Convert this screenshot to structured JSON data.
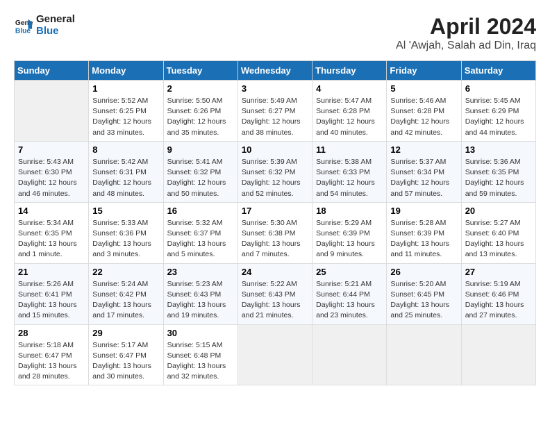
{
  "logo": {
    "line1": "General",
    "line2": "Blue"
  },
  "title": "April 2024",
  "location": "Al 'Awjah, Salah ad Din, Iraq",
  "weekdays": [
    "Sunday",
    "Monday",
    "Tuesday",
    "Wednesday",
    "Thursday",
    "Friday",
    "Saturday"
  ],
  "weeks": [
    [
      null,
      {
        "day": 1,
        "sunrise": "Sunrise: 5:52 AM",
        "sunset": "Sunset: 6:25 PM",
        "daylight": "Daylight: 12 hours and 33 minutes."
      },
      {
        "day": 2,
        "sunrise": "Sunrise: 5:50 AM",
        "sunset": "Sunset: 6:26 PM",
        "daylight": "Daylight: 12 hours and 35 minutes."
      },
      {
        "day": 3,
        "sunrise": "Sunrise: 5:49 AM",
        "sunset": "Sunset: 6:27 PM",
        "daylight": "Daylight: 12 hours and 38 minutes."
      },
      {
        "day": 4,
        "sunrise": "Sunrise: 5:47 AM",
        "sunset": "Sunset: 6:28 PM",
        "daylight": "Daylight: 12 hours and 40 minutes."
      },
      {
        "day": 5,
        "sunrise": "Sunrise: 5:46 AM",
        "sunset": "Sunset: 6:28 PM",
        "daylight": "Daylight: 12 hours and 42 minutes."
      },
      {
        "day": 6,
        "sunrise": "Sunrise: 5:45 AM",
        "sunset": "Sunset: 6:29 PM",
        "daylight": "Daylight: 12 hours and 44 minutes."
      }
    ],
    [
      {
        "day": 7,
        "sunrise": "Sunrise: 5:43 AM",
        "sunset": "Sunset: 6:30 PM",
        "daylight": "Daylight: 12 hours and 46 minutes."
      },
      {
        "day": 8,
        "sunrise": "Sunrise: 5:42 AM",
        "sunset": "Sunset: 6:31 PM",
        "daylight": "Daylight: 12 hours and 48 minutes."
      },
      {
        "day": 9,
        "sunrise": "Sunrise: 5:41 AM",
        "sunset": "Sunset: 6:32 PM",
        "daylight": "Daylight: 12 hours and 50 minutes."
      },
      {
        "day": 10,
        "sunrise": "Sunrise: 5:39 AM",
        "sunset": "Sunset: 6:32 PM",
        "daylight": "Daylight: 12 hours and 52 minutes."
      },
      {
        "day": 11,
        "sunrise": "Sunrise: 5:38 AM",
        "sunset": "Sunset: 6:33 PM",
        "daylight": "Daylight: 12 hours and 54 minutes."
      },
      {
        "day": 12,
        "sunrise": "Sunrise: 5:37 AM",
        "sunset": "Sunset: 6:34 PM",
        "daylight": "Daylight: 12 hours and 57 minutes."
      },
      {
        "day": 13,
        "sunrise": "Sunrise: 5:36 AM",
        "sunset": "Sunset: 6:35 PM",
        "daylight": "Daylight: 12 hours and 59 minutes."
      }
    ],
    [
      {
        "day": 14,
        "sunrise": "Sunrise: 5:34 AM",
        "sunset": "Sunset: 6:35 PM",
        "daylight": "Daylight: 13 hours and 1 minute."
      },
      {
        "day": 15,
        "sunrise": "Sunrise: 5:33 AM",
        "sunset": "Sunset: 6:36 PM",
        "daylight": "Daylight: 13 hours and 3 minutes."
      },
      {
        "day": 16,
        "sunrise": "Sunrise: 5:32 AM",
        "sunset": "Sunset: 6:37 PM",
        "daylight": "Daylight: 13 hours and 5 minutes."
      },
      {
        "day": 17,
        "sunrise": "Sunrise: 5:30 AM",
        "sunset": "Sunset: 6:38 PM",
        "daylight": "Daylight: 13 hours and 7 minutes."
      },
      {
        "day": 18,
        "sunrise": "Sunrise: 5:29 AM",
        "sunset": "Sunset: 6:39 PM",
        "daylight": "Daylight: 13 hours and 9 minutes."
      },
      {
        "day": 19,
        "sunrise": "Sunrise: 5:28 AM",
        "sunset": "Sunset: 6:39 PM",
        "daylight": "Daylight: 13 hours and 11 minutes."
      },
      {
        "day": 20,
        "sunrise": "Sunrise: 5:27 AM",
        "sunset": "Sunset: 6:40 PM",
        "daylight": "Daylight: 13 hours and 13 minutes."
      }
    ],
    [
      {
        "day": 21,
        "sunrise": "Sunrise: 5:26 AM",
        "sunset": "Sunset: 6:41 PM",
        "daylight": "Daylight: 13 hours and 15 minutes."
      },
      {
        "day": 22,
        "sunrise": "Sunrise: 5:24 AM",
        "sunset": "Sunset: 6:42 PM",
        "daylight": "Daylight: 13 hours and 17 minutes."
      },
      {
        "day": 23,
        "sunrise": "Sunrise: 5:23 AM",
        "sunset": "Sunset: 6:43 PM",
        "daylight": "Daylight: 13 hours and 19 minutes."
      },
      {
        "day": 24,
        "sunrise": "Sunrise: 5:22 AM",
        "sunset": "Sunset: 6:43 PM",
        "daylight": "Daylight: 13 hours and 21 minutes."
      },
      {
        "day": 25,
        "sunrise": "Sunrise: 5:21 AM",
        "sunset": "Sunset: 6:44 PM",
        "daylight": "Daylight: 13 hours and 23 minutes."
      },
      {
        "day": 26,
        "sunrise": "Sunrise: 5:20 AM",
        "sunset": "Sunset: 6:45 PM",
        "daylight": "Daylight: 13 hours and 25 minutes."
      },
      {
        "day": 27,
        "sunrise": "Sunrise: 5:19 AM",
        "sunset": "Sunset: 6:46 PM",
        "daylight": "Daylight: 13 hours and 27 minutes."
      }
    ],
    [
      {
        "day": 28,
        "sunrise": "Sunrise: 5:18 AM",
        "sunset": "Sunset: 6:47 PM",
        "daylight": "Daylight: 13 hours and 28 minutes."
      },
      {
        "day": 29,
        "sunrise": "Sunrise: 5:17 AM",
        "sunset": "Sunset: 6:47 PM",
        "daylight": "Daylight: 13 hours and 30 minutes."
      },
      {
        "day": 30,
        "sunrise": "Sunrise: 5:15 AM",
        "sunset": "Sunset: 6:48 PM",
        "daylight": "Daylight: 13 hours and 32 minutes."
      },
      null,
      null,
      null,
      null
    ]
  ]
}
